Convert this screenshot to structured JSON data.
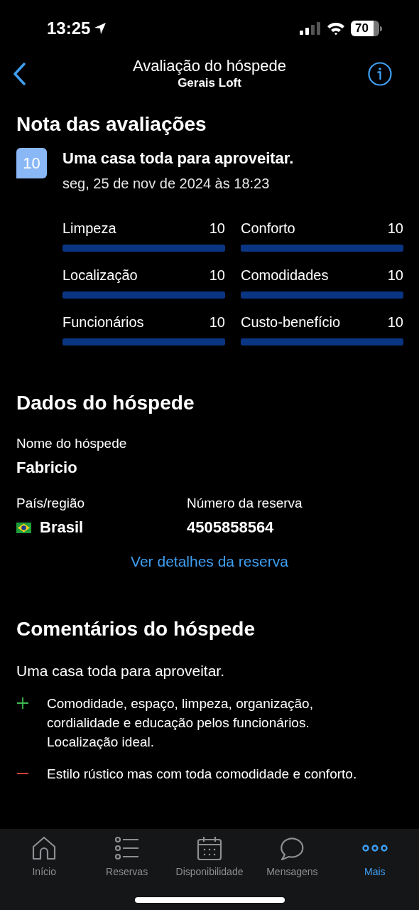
{
  "status_bar": {
    "time": "13:25",
    "battery": "70"
  },
  "header": {
    "title": "Avaliação do hóspede",
    "subtitle": "Gerais Loft"
  },
  "ratings": {
    "title": "Nota das avaliações",
    "score": "10",
    "headline": "Uma casa toda para aproveitar.",
    "date": "seg, 25 de nov de 2024 às 18:23",
    "categories": [
      {
        "label": "Limpeza",
        "value": "10",
        "level": 1
      },
      {
        "label": "Conforto",
        "value": "10",
        "level": 1
      },
      {
        "label": "Localização",
        "value": "10",
        "level": 1
      },
      {
        "label": "Comodidades",
        "value": "10",
        "level": 1
      },
      {
        "label": "Funcionários",
        "value": "10",
        "level": 1
      },
      {
        "label": "Custo-benefício",
        "value": "10",
        "level": 1
      }
    ]
  },
  "guest": {
    "title": "Dados do hóspede",
    "name_label": "Nome do hóspede",
    "name": "Fabricio",
    "country_label": "País/região",
    "country": "Brasil",
    "booking_label": "Número da reserva",
    "booking_number": "4505858564",
    "details_link": "Ver detalhes da reserva"
  },
  "comments": {
    "title": "Comentários do hóspede",
    "headline": "Uma casa toda para aproveitar.",
    "items": [
      {
        "kind": "positive",
        "text": "Comodidade, espaço, limpeza, organização, cordialidade e educação pelos funcionários. Localização ideal."
      },
      {
        "kind": "negative",
        "text": "Estilo rústico mas com toda comodidade e conforto."
      }
    ]
  },
  "tab_bar": [
    {
      "label": "Início",
      "selected": false
    },
    {
      "label": "Reservas",
      "selected": false
    },
    {
      "label": "Disponibilidade",
      "selected": false
    },
    {
      "label": "Mensagens",
      "selected": false
    },
    {
      "label": "Mais",
      "selected": true
    }
  ]
}
